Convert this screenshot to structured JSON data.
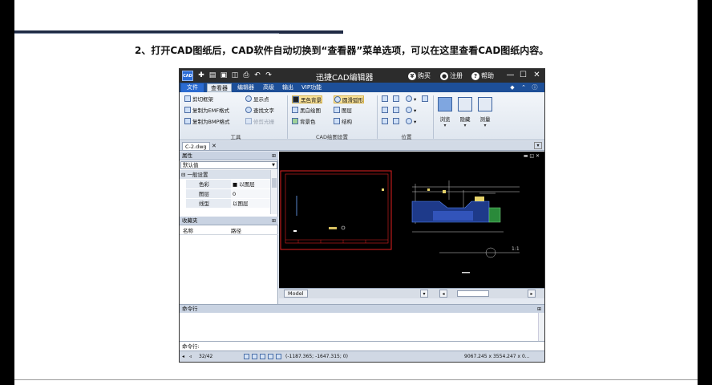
{
  "slide": {
    "caption": "2、打开CAD图纸后，CAD软件自动切换到“查看器”菜单选项，可以在这里查看CAD图纸内容。"
  },
  "app": {
    "logo_text": "CAD",
    "title": "迅捷CAD编辑器",
    "title_buttons": [
      {
        "icon": "¥",
        "label": "购买"
      },
      {
        "icon": "👤",
        "label": "注册"
      },
      {
        "icon": "?",
        "label": "帮助"
      }
    ],
    "menu": {
      "file": "文件",
      "tabs": [
        "查看器",
        "编辑器",
        "高级",
        "输出",
        "VIP功能"
      ]
    },
    "ribbon": {
      "tools": {
        "label": "工具",
        "items": [
          "剪切框架",
          "复制为EMF格式",
          "复制为BMP格式",
          "显示点",
          "查找文字",
          "修剪光栅"
        ]
      },
      "drawing_settings": {
        "label": "CAD绘图设置",
        "items": [
          "黑色背景",
          "黑白绘图",
          "背景色",
          "圆滑弧形",
          "图层",
          "结构"
        ]
      },
      "position": {
        "label": "位置"
      },
      "big_buttons": [
        "浏览",
        "隐藏",
        "测量"
      ]
    },
    "document_tab": "C-2.dwg",
    "properties_panel": {
      "title": "属性",
      "combo": "默认值",
      "group": "一般设置",
      "rows": [
        {
          "key": "色彩",
          "value": "■ 以图层"
        },
        {
          "key": "图层",
          "value": "0"
        },
        {
          "key": "线型",
          "value": "以图层"
        }
      ]
    },
    "favorites_panel": {
      "title": "收藏夹",
      "col_name": "名称",
      "col_path": "路径"
    },
    "model_tab": "Model",
    "command_panel": {
      "title": "命令行",
      "input_label": "命令行:"
    },
    "status": {
      "page": "32/42",
      "coords": "(-1187.365; -1647.315; 0)",
      "size": "9067.245 x 3554.247 x 0..."
    },
    "canvas_scale_label": "1:1"
  }
}
